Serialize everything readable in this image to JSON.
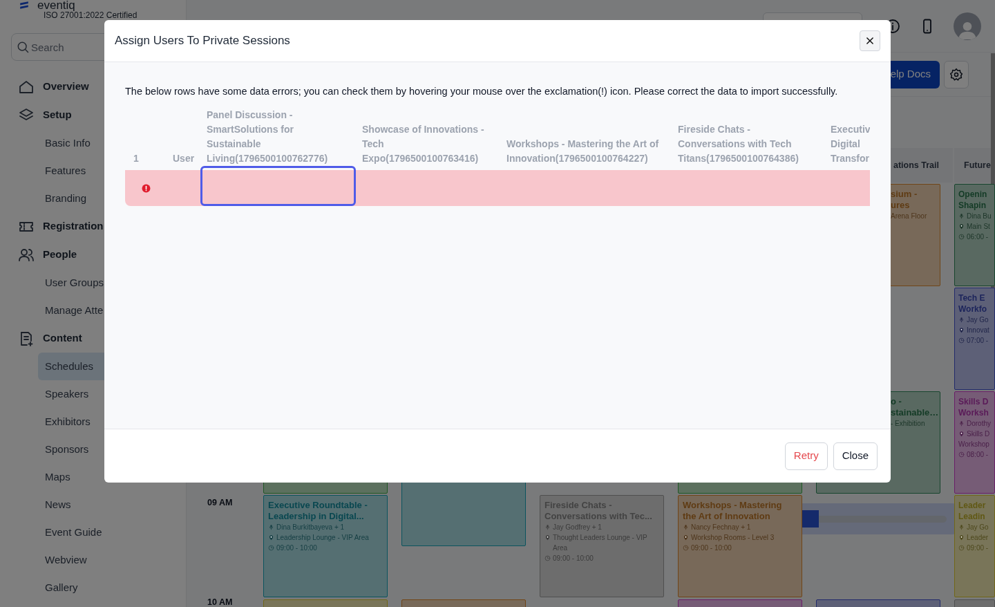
{
  "sidebar": {
    "logo": "eventiq",
    "tagline": "ISO 27001:2022 Certified",
    "search": {
      "placeholder": "Search"
    },
    "items": [
      {
        "label": "Overview",
        "selected": false
      },
      {
        "label": "Setup",
        "selected": false,
        "children": [
          {
            "label": "Basic Info",
            "selected": false
          },
          {
            "label": "Features",
            "selected": false
          },
          {
            "label": "Branding",
            "selected": false
          }
        ]
      },
      {
        "label": "Registration",
        "selected": false
      },
      {
        "label": "People",
        "selected": false,
        "children": [
          {
            "label": "User Groups",
            "selected": false
          },
          {
            "label": "Manage Atte",
            "selected": false
          }
        ]
      },
      {
        "label": "Content",
        "selected": false,
        "children": [
          {
            "label": "Schedules",
            "selected": true
          },
          {
            "label": "Speakers",
            "selected": false
          },
          {
            "label": "Exhibitors",
            "selected": false
          },
          {
            "label": "Sponsors",
            "selected": false
          },
          {
            "label": "Maps",
            "selected": false
          },
          {
            "label": "News",
            "selected": false
          },
          {
            "label": "Event Guide",
            "selected": false
          },
          {
            "label": "Webview",
            "selected": false
          },
          {
            "label": "Gallery",
            "selected": false
          }
        ]
      }
    ]
  },
  "header": {
    "help_button": "elp Docs"
  },
  "schedule": {
    "times": [
      "09 AM",
      "10 AM"
    ],
    "columns": [
      {
        "kind": "full",
        "slots": [
          {
            "kind": "empty"
          },
          {
            "kind": "empty"
          },
          {
            "kind": "event",
            "color": "#1f5724"
          },
          {
            "kind": "event",
            "color": "#0a545e",
            "title": [
              "Executive Roundtable -",
              "Leadership in Digital..."
            ],
            "details": [
              {
                "kind": "speaker",
                "text": "Dina Burkitbayeva + 1"
              },
              {
                "kind": "location",
                "text": "Leadership Lounge - VIP Area"
              },
              {
                "kind": "time",
                "text": "09:00 - 10:00"
              }
            ]
          },
          {
            "kind": "event",
            "color": "#716717"
          }
        ]
      },
      {
        "kind": "full",
        "slots": [
          {
            "kind": "empty"
          },
          {
            "kind": "empty"
          },
          {
            "kind": "long-event",
            "color": "#0a545e"
          },
          {
            "kind": "empty"
          },
          {
            "kind": "event",
            "color": "#704516"
          }
        ]
      },
      {
        "kind": "full",
        "slots": [
          {
            "kind": "empty"
          },
          {
            "kind": "empty"
          },
          {
            "kind": "empty"
          },
          {
            "kind": "event",
            "color": "#4f4f4f",
            "title": [
              "Fireside Chats -",
              "Conversations with Tec..."
            ],
            "details": [
              {
                "kind": "speaker",
                "text": "Jay Godfrey + 1"
              },
              {
                "kind": "location",
                "text": "Thought Leaders Lounge - VIP Area"
              },
              {
                "kind": "time",
                "text": "09:00 - 10:00"
              }
            ]
          },
          {
            "kind": "empty"
          }
        ]
      },
      {
        "kind": "full",
        "slots": [
          {
            "kind": "empty"
          },
          {
            "kind": "empty"
          },
          {
            "kind": "event",
            "color": "#1f5724"
          },
          {
            "kind": "event",
            "color": "#704516",
            "title": [
              "Workshops - Mastering",
              "the Art of Innovation"
            ],
            "details": [
              {
                "kind": "speaker",
                "text": "Nancy Fechnay + 1"
              },
              {
                "kind": "location",
                "text": "Workshop Rooms - Level 3"
              },
              {
                "kind": "time",
                "text": "09:00 - 10:00"
              }
            ]
          },
          {
            "kind": "event",
            "color": "#6a1e68"
          }
        ]
      },
      {
        "kind": "covered",
        "header": "ations Trail",
        "slots": [
          {
            "kind": "event",
            "color": "#704516",
            "title": [
              "sium -",
              "ures"
            ],
            "details": [
              {
                "kind": "plain",
                "text": "Arena Floor"
              }
            ]
          },
          {
            "kind": "empty"
          },
          {
            "kind": "event",
            "color": "#17452d",
            "title": [
              "o -",
              "stainable…"
            ],
            "details": [
              {
                "kind": "plain",
                "text": "- Exhibition"
              }
            ]
          },
          {
            "kind": "empty"
          },
          {
            "kind": "event",
            "color": "#212a6b"
          }
        ]
      },
      {
        "kind": "edge",
        "header": "Future",
        "slots": [
          {
            "kind": "event",
            "color": "#17452d",
            "title": [
              "Openin",
              "Shapin"
            ],
            "details": [
              {
                "kind": "speaker",
                "text": "Dina Bu"
              },
              {
                "kind": "location",
                "text": "Main St"
              },
              {
                "kind": "time",
                "text": "06:00 -"
              }
            ]
          },
          {
            "kind": "event",
            "color": "#212a6b",
            "title": [
              "Tech E",
              "Workfo"
            ],
            "details": [
              {
                "kind": "speaker",
                "text": "Jay Go"
              },
              {
                "kind": "location",
                "text": "Innovat"
              },
              {
                "kind": "time",
                "text": "07:00 -"
              }
            ]
          },
          {
            "kind": "event",
            "color": "#6a1e68",
            "title": [
              "Skills D",
              "Worksh"
            ],
            "details": [
              {
                "kind": "speaker",
                "text": "Dorothy"
              },
              {
                "kind": "location",
                "text": "Skills D"
              },
              {
                "kind": "plain",
                "text": "Workshop"
              },
              {
                "kind": "time",
                "text": "08:00 -"
              }
            ]
          },
          {
            "kind": "event",
            "color": "#716717",
            "title": [
              "Leader",
              "Leadin"
            ],
            "details": [
              {
                "kind": "speaker",
                "text": "Jay Go"
              },
              {
                "kind": "location",
                "text": "Leader"
              },
              {
                "kind": "time",
                "text": "09:00 -"
              }
            ]
          },
          {
            "kind": "event",
            "color": "#4f4f4f"
          }
        ]
      }
    ]
  },
  "modal": {
    "title": "Assign Users To Private Sessions",
    "message": "The below rows have some data errors; you can check them by hovering your mouse over the exclamation(!) icon. Please correct the data to import successfully.",
    "table": {
      "columns": [
        "1",
        "User",
        "Panel Discussion - SmartSolutions for Sustainable Living(1796500100762776)",
        "Showcase of Innovations - Tech Expo(1796500100763416)",
        "Workshops - Mastering the Art of Innovation(1796500100764227)",
        "Fireside Chats - Conversations with Tech Titans(1796500100764386)",
        "Executiv Digital Transfor"
      ],
      "rows": [
        {
          "error": true,
          "cells": [
            {
              "selected": false
            },
            {
              "selected": true
            },
            {
              "selected": false
            },
            {
              "selected": false
            },
            {
              "selected": false
            },
            {
              "selected": false
            }
          ]
        }
      ]
    },
    "buttons": [
      {
        "label": "Retry",
        "kind": "danger"
      },
      {
        "label": "Close",
        "kind": "secondary"
      }
    ]
  }
}
